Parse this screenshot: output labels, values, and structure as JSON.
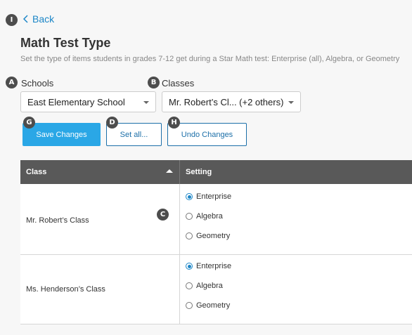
{
  "callouts": {
    "i": "I",
    "a": "A",
    "b": "B",
    "c": "C",
    "d": "D",
    "g": "G",
    "h": "H"
  },
  "nav": {
    "back_label": "Back"
  },
  "header": {
    "title": "Math Test Type",
    "subtitle": "Set the type of items students in grades 7-12 get during a Star Math test: Enterprise (all), Algebra, or Geometry"
  },
  "filters": {
    "schools_label": "Schools",
    "schools_value": "East Elementary School",
    "classes_label": "Classes",
    "classes_value": "Mr. Robert’s Cl... (+2 others)"
  },
  "actions": {
    "save_label": "Save Changes",
    "set_all_label": "Set all...",
    "undo_label": "Undo Changes"
  },
  "table": {
    "col_class": "Class",
    "col_setting": "Setting",
    "rows": [
      {
        "class_name": "Mr. Robert’s Class",
        "options": [
          "Enterprise",
          "Algebra",
          "Geometry"
        ],
        "selected": "Enterprise"
      },
      {
        "class_name": "Ms. Henderson’s Class",
        "options": [
          "Enterprise",
          "Algebra",
          "Geometry"
        ],
        "selected": "Enterprise"
      }
    ]
  },
  "colors": {
    "accent": "#2aa7e6",
    "link": "#1c86c7",
    "header_bg": "#595959"
  }
}
